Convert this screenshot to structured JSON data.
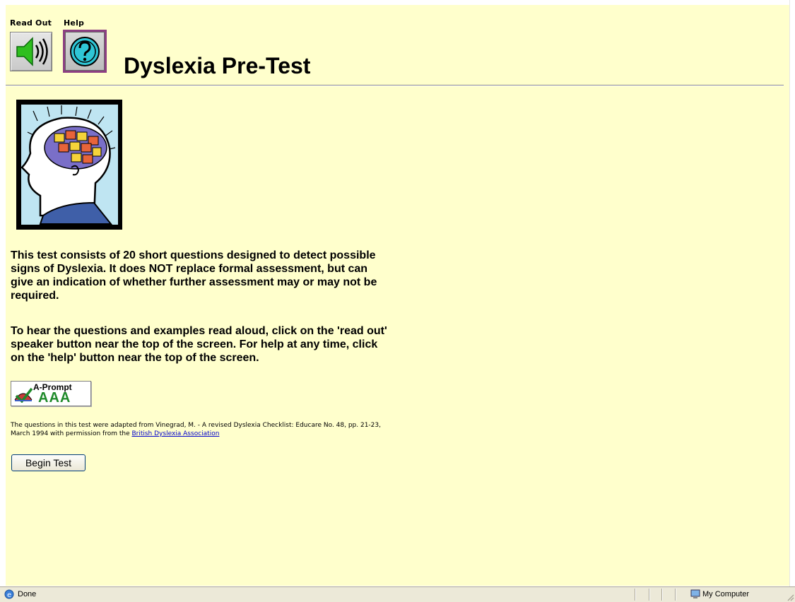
{
  "toolbar": {
    "readout_label": "Read Out",
    "help_label": "Help",
    "readout_icon": "speaker-icon",
    "help_icon": "question-icon"
  },
  "page": {
    "title": "Dyslexia Pre-Test",
    "paragraph1": "This test consists of 20 short questions designed to detect possible signs of Dyslexia.  It does NOT replace formal assessment, but can give an indication of whether further assessment may or may not be required.",
    "paragraph2": "To hear the questions and examples read aloud, click on the 'read out' speaker button near the top of the screen.  For help at any time, click on the 'help' button near the top of the screen.",
    "badge": {
      "name": "A-Prompt",
      "level": "AAA"
    },
    "credit_text": "The questions in this test were adapted from Vinegrad, M. - A revised Dyslexia Checklist: Educare No. 48, pp. 21-23, March 1994 with permission from the ",
    "credit_link": "British Dyslexia Association",
    "begin_button": "Begin Test"
  },
  "statusbar": {
    "status": "Done",
    "zone": "My Computer"
  },
  "colors": {
    "background": "#ffffcc",
    "help_border": "#8c3f82",
    "link": "#0000cc",
    "badge_level": "#1f8a2a"
  }
}
